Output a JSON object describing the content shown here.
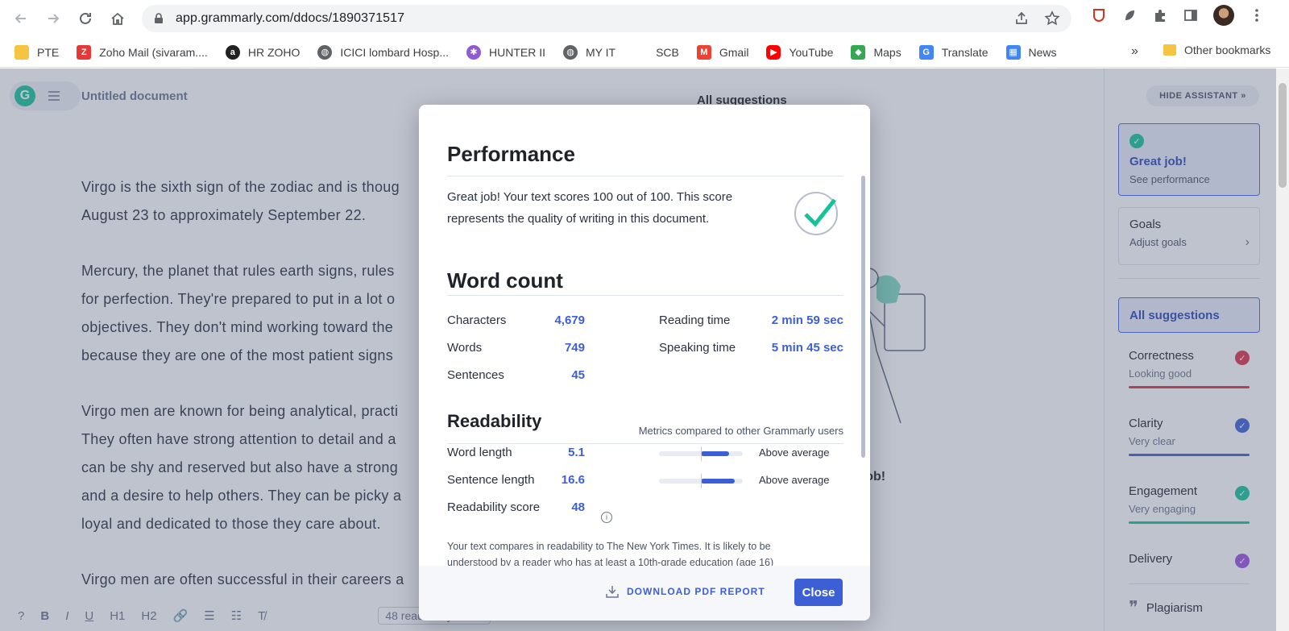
{
  "browser": {
    "url": "app.grammarly.com/ddocs/1890371517",
    "bookmarks": [
      {
        "label": "PTE",
        "color": "#f5c542"
      },
      {
        "label": "Zoho Mail (sivaram....",
        "color": "#e53935"
      },
      {
        "label": "HR ZOHO",
        "color": "#222222"
      },
      {
        "label": "ICICI lombard Hosp...",
        "color": "#5f6368"
      },
      {
        "label": "HUNTER II",
        "color": "#8e5bd0"
      },
      {
        "label": "MY IT",
        "color": "#5f6368"
      },
      {
        "label": "SCB",
        "color": "#ffffff"
      },
      {
        "label": "Gmail",
        "color": "#ea4335"
      },
      {
        "label": "YouTube",
        "color": "#ff0000"
      },
      {
        "label": "Maps",
        "color": "#34a853"
      },
      {
        "label": "Translate",
        "color": "#4285f4"
      },
      {
        "label": "News",
        "color": "#4285f4"
      }
    ],
    "bookmarks_more": "»",
    "other_bookmarks": "Other bookmarks"
  },
  "editor": {
    "doc_title": "Untitled document",
    "paragraphs": [
      [
        "Virgo is the sixth sign of the zodiac and is thoug",
        "August 23 to approximately September 22."
      ],
      [
        "Mercury, the planet that rules earth signs, rules",
        "for perfection. They're prepared to put in a lot o",
        "objectives. They don't mind working toward the",
        "because they are one of the most patient signs"
      ],
      [
        "Virgo men are known for being analytical, practi",
        "They often have strong attention to detail and a",
        "can be shy and reserved but also have a strong",
        "and a desire to help others. They can be picky a",
        "loyal and dedicated to those they care about."
      ],
      [
        "Virgo men are often successful in their careers a"
      ]
    ],
    "panel_title": "All suggestions",
    "great_job_behind": "t job!",
    "readability_pill": "48 readability score"
  },
  "assistant": {
    "hide_label": "HIDE ASSISTANT",
    "great": {
      "title": "Great job!",
      "subtitle": "See performance"
    },
    "goals": {
      "title": "Goals",
      "subtitle": "Adjust goals"
    },
    "all_suggestions": "All suggestions",
    "categories": [
      {
        "name": "Correctness",
        "desc": "Looking good",
        "color": "#e0314a"
      },
      {
        "name": "Clarity",
        "desc": "Very clear",
        "color": "#3d5fd6"
      },
      {
        "name": "Engagement",
        "desc": "Very engaging",
        "color": "#15c39a"
      },
      {
        "name": "Delivery",
        "desc": "",
        "color": "#9b51e0"
      }
    ],
    "plagiarism": "Plagiarism"
  },
  "modal": {
    "performance_title": "Performance",
    "performance_text_1": "Great job! Your text scores 100 out of 100. This score",
    "performance_text_2": "represents the quality of writing in this document.",
    "word_count_title": "Word count",
    "stats_left": [
      {
        "label": "Characters",
        "value": "4,679"
      },
      {
        "label": "Words",
        "value": "749"
      },
      {
        "label": "Sentences",
        "value": "45"
      }
    ],
    "stats_right": [
      {
        "label": "Reading time",
        "value": "2 min 59 sec"
      },
      {
        "label": "Speaking time",
        "value": "5 min 45 sec"
      }
    ],
    "readability_title": "Readability",
    "readability_note": "Metrics compared to other Grammarly users",
    "readability_rows": [
      {
        "label": "Word length",
        "value": "5.1",
        "meter": "Above average",
        "fill_from": 0.5,
        "fill_to": 0.84
      },
      {
        "label": "Sentence length",
        "value": "16.6",
        "meter": "Above average",
        "fill_from": 0.5,
        "fill_to": 0.9
      },
      {
        "label": "Readability score",
        "value": "48"
      }
    ],
    "readability_text_1": "Your text compares in readability to The New York Times. It is likely to be",
    "readability_text_2": "understood by a reader who has at least a 10th-grade education (age 16)",
    "download_label": "DOWNLOAD PDF REPORT",
    "close_label": "Close"
  },
  "colors": {
    "accent": "#3d5fd6",
    "success": "#15c39a"
  },
  "icons": [
    "back-icon",
    "forward-icon",
    "reload-icon",
    "home-icon",
    "lock-icon",
    "share-icon",
    "star-icon",
    "puzzle-icon",
    "sidepanel-icon",
    "kebab-icon",
    "checkmark-icon",
    "download-icon",
    "info-icon"
  ]
}
